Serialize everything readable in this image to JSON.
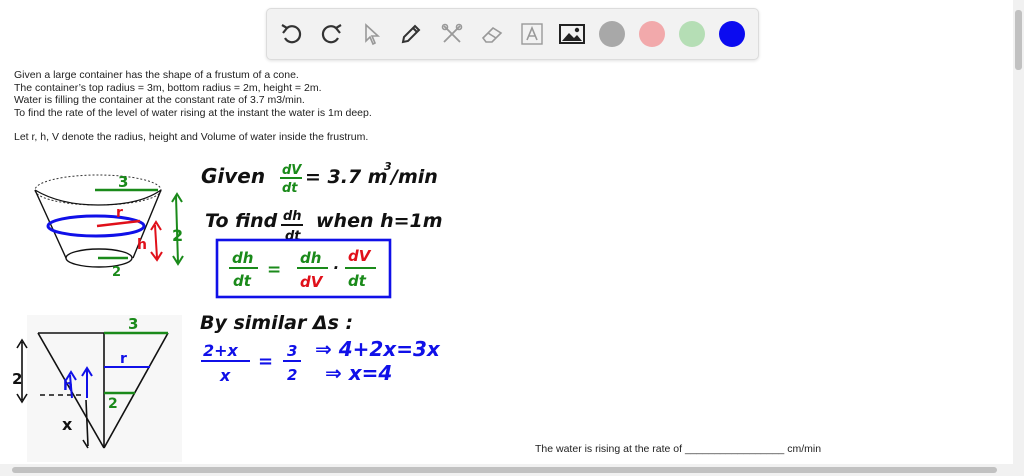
{
  "toolbar": {
    "tools": [
      "undo-icon",
      "redo-icon",
      "pointer-icon",
      "pen-icon",
      "scissors-icon",
      "eraser-icon",
      "text-icon",
      "image-icon"
    ],
    "colors": [
      {
        "name": "gray",
        "hex": "#a8a8a8"
      },
      {
        "name": "pink",
        "hex": "#f2a9ab"
      },
      {
        "name": "light-green",
        "hex": "#b5deb5"
      },
      {
        "name": "blue",
        "hex": "#0b0bf0"
      }
    ]
  },
  "problem": {
    "lines": [
      "Given a large container has the shape of a frustum of a cone.",
      "The container’s top radius = 3m, bottom radius = 2m, height = 2m.",
      "Water is filling the container at the constant rate of 3.7 m3/min.",
      "To find the rate of the level of water rising at the instant the water is 1m deep."
    ],
    "note": "Let r, h, V denote the radius, height and Volume of water inside the frustrum."
  },
  "answer": {
    "prefix": "The water is rising at the rate of",
    "blank": "_________________",
    "unit": "cm/min"
  },
  "handwriting": {
    "given": "Given",
    "dv": "dV",
    "dt": "dt",
    "rate_value": "= 3.7 m",
    "cube": "3",
    "per_min": "/min",
    "to_find": "To find",
    "dh": "dh",
    "when": "when h=1m",
    "formula": {
      "lhs_num": "dh",
      "lhs_den": "dt",
      "eq": "=",
      "m1_num": "dh",
      "m1_den": "dV",
      "dot": "·",
      "m2_num": "dV",
      "m2_den": "dt"
    },
    "similar": "By similar Δs :",
    "ratio_num": "2+x",
    "ratio_den": "x",
    "ratio_eq": "=",
    "frac_num": "3",
    "frac_den": "2",
    "implies1": "⇒ 4+2x=3x",
    "implies2": "⇒ x=4",
    "label_3": "3",
    "label_r": "r",
    "label_2": "2",
    "label_h": "h",
    "label_x": "x",
    "label_3b": "3",
    "label_rb": "r",
    "label_2b": "2",
    "label_2side": "2",
    "label_hb": "h"
  },
  "colors": {
    "green": "#1a8a1a",
    "red": "#e0101a",
    "blue": "#1010e8",
    "black": "#111111"
  }
}
